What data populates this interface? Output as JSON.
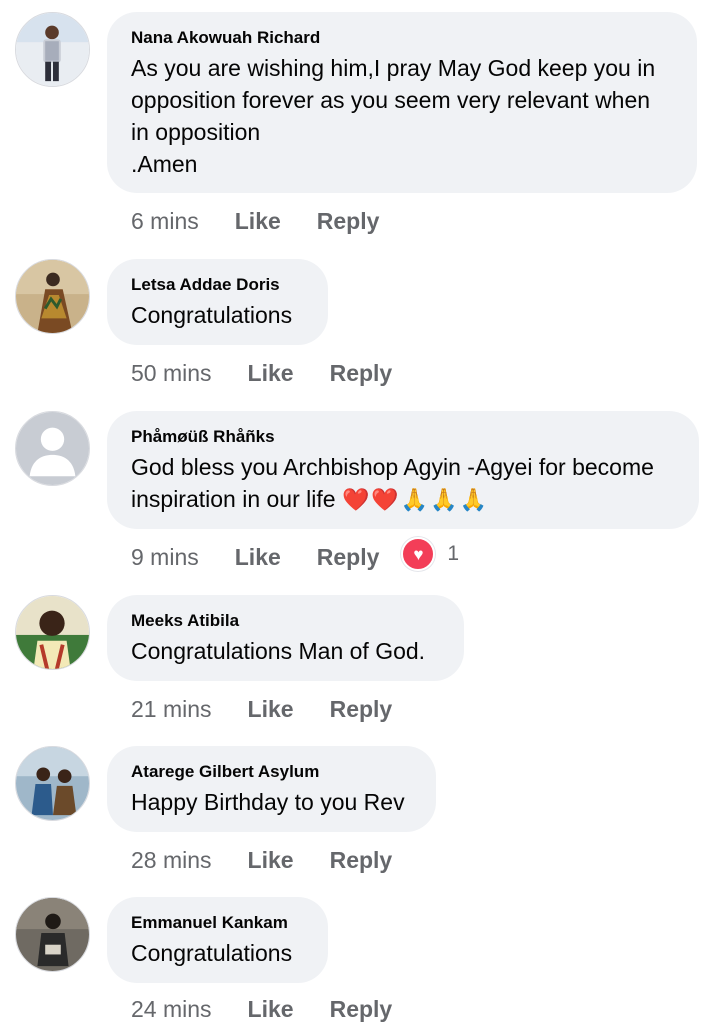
{
  "comments": [
    {
      "author": "Nana Akowuah Richard",
      "text_lines": [
        "As you are wishing him,I pray May God keep you in",
        "opposition forever as you seem very relevant when",
        "in opposition",
        ".Amen"
      ],
      "time": "6 mins",
      "like_label": "Like",
      "reply_label": "Reply"
    },
    {
      "author": "Letsa Addae Doris",
      "text_lines": [
        "Congratulations"
      ],
      "time": "50 mins",
      "like_label": "Like",
      "reply_label": "Reply"
    },
    {
      "author": "Phåmøüß Rhåñks",
      "text_lines": [
        "God bless you Archbishop Agyin -Agyei for become",
        "inspiration in our life"
      ],
      "text_emojis": "❤️❤️🙏🙏🙏",
      "time": "9 mins",
      "like_label": "Like",
      "reply_label": "Reply",
      "reaction_icon": "heart-icon",
      "reaction_count": "1"
    },
    {
      "author": "Meeks Atibila",
      "text_lines": [
        "Congratulations Man of God."
      ],
      "time": "21 mins",
      "like_label": "Like",
      "reply_label": "Reply"
    },
    {
      "author": "Atarege Gilbert Asylum",
      "text_lines": [
        "Happy Birthday to you Rev"
      ],
      "time": "28 mins",
      "like_label": "Like",
      "reply_label": "Reply"
    },
    {
      "author": "Emmanuel Kankam",
      "text_lines": [
        "Congratulations"
      ],
      "time": "24 mins",
      "like_label": "Like",
      "reply_label": "Reply"
    }
  ],
  "colors": {
    "bubble": "#f0f2f5",
    "secondary_text": "#65676b",
    "love_reaction": "#f33e58"
  }
}
